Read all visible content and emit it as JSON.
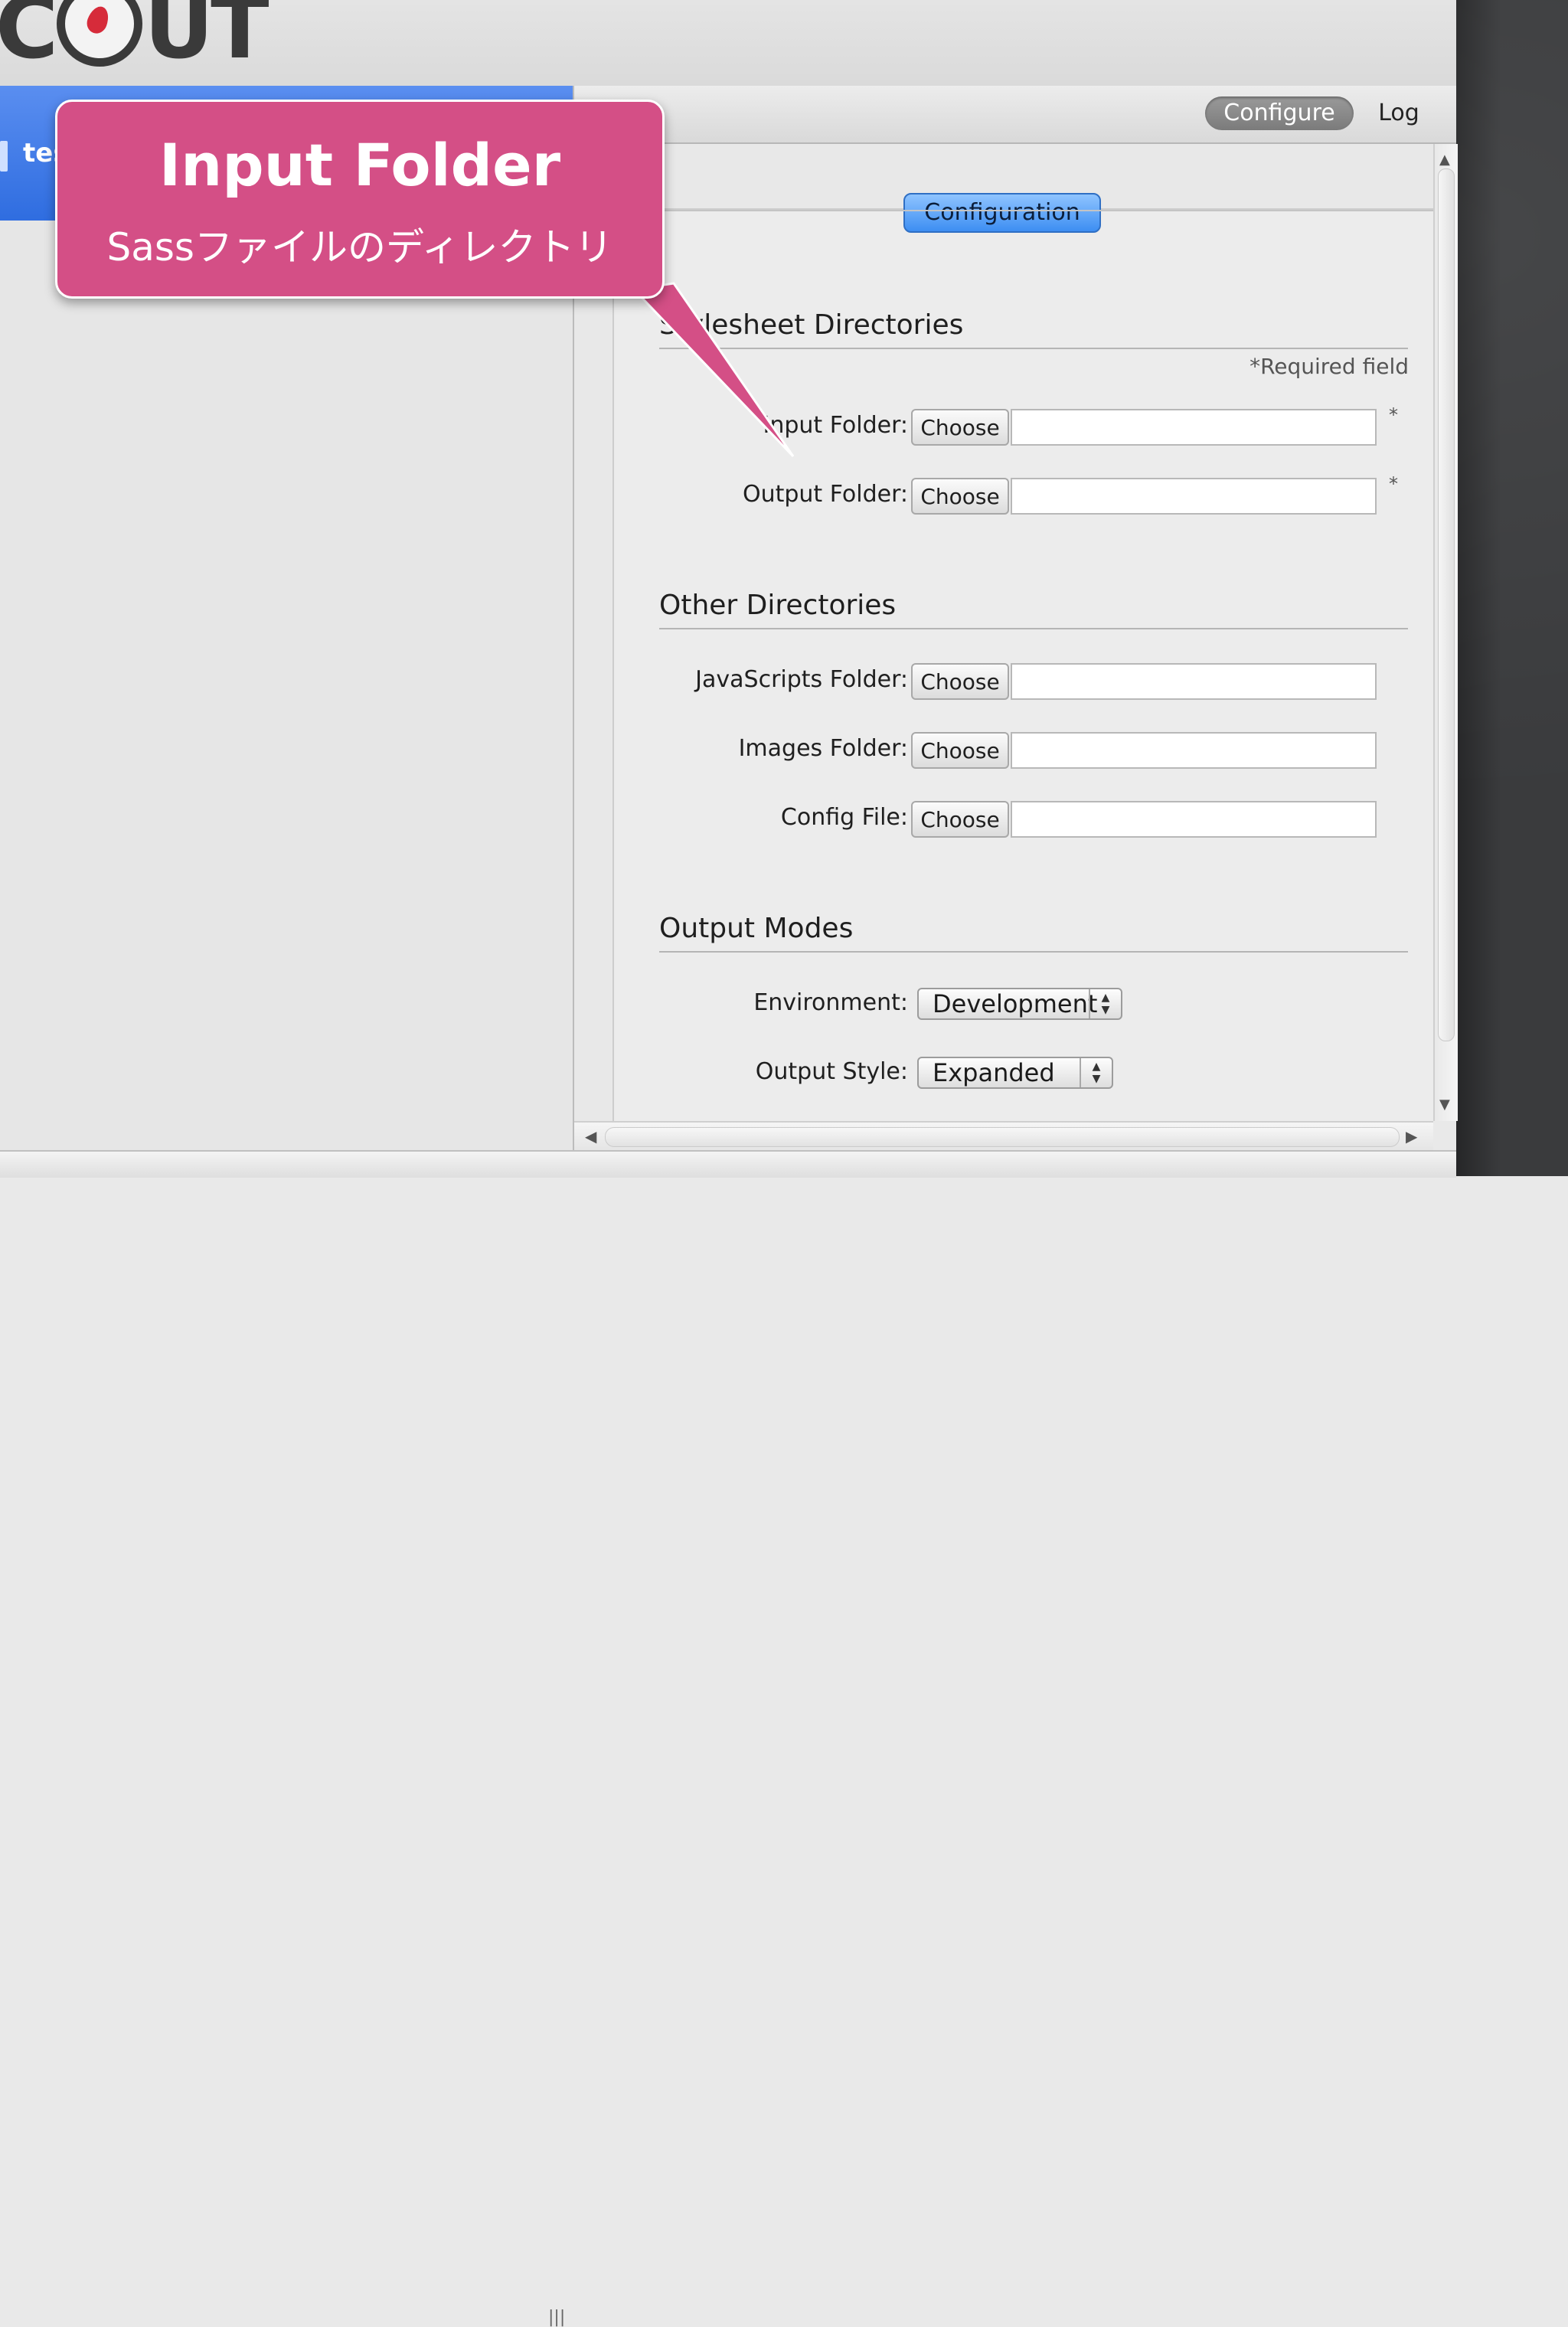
{
  "app": {
    "logo_text_left": "C",
    "logo_text_right": "UT"
  },
  "sidebar": {
    "items": [
      {
        "label": "tes"
      }
    ]
  },
  "toolbar": {
    "tabs": [
      {
        "label": "Configure",
        "selected": true
      },
      {
        "label": "Log",
        "selected": false
      }
    ]
  },
  "main": {
    "tab_label": "Configuration",
    "required_note": "*Required field",
    "sections": [
      {
        "title": "Stylesheet Directories",
        "rows": [
          {
            "label": "Input Folder:",
            "button": "Choose",
            "value": "",
            "required": "*"
          },
          {
            "label": "Output Folder:",
            "button": "Choose",
            "value": "",
            "required": "*"
          }
        ]
      },
      {
        "title": "Other Directories",
        "rows": [
          {
            "label": "JavaScripts Folder:",
            "button": "Choose",
            "value": ""
          },
          {
            "label": "Images Folder:",
            "button": "Choose",
            "value": ""
          },
          {
            "label": "Config File:",
            "button": "Choose",
            "value": ""
          }
        ]
      },
      {
        "title": "Output Modes",
        "rows": [
          {
            "label": "Environment:",
            "selected": "Development"
          },
          {
            "label": "Output Style:",
            "selected": "Expanded"
          }
        ]
      }
    ]
  },
  "callout": {
    "title": "Input Folder",
    "subtitle": "Sassファイルのディレクトリ",
    "color": "#d44f86"
  },
  "colors": {
    "accent_blue": "#3d8ef2",
    "sidebar_selection": "#2f6de0"
  },
  "icons": {
    "logo": "compass-logo-icon",
    "scroll_up": "arrow-up-icon",
    "scroll_down": "arrow-down-icon",
    "scroll_left": "arrow-left-icon",
    "scroll_right": "arrow-right-icon",
    "popup_arrows": "updown-arrows-icon",
    "split": "split-handle-icon"
  }
}
